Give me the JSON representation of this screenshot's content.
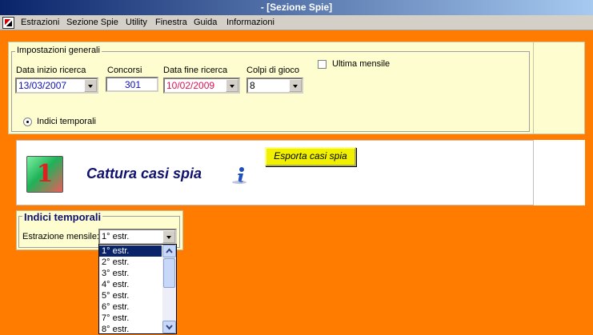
{
  "window": {
    "title": "- [Sezione Spie]"
  },
  "menu": [
    "Estrazioni",
    "Sezione Spie",
    "Utility",
    "Finestra",
    "Guida",
    "Informazioni"
  ],
  "settings": {
    "group_label": "Impostazioni generali",
    "start_date_label": "Data inizio ricerca",
    "start_date_value": "13/03/2007",
    "concorsi_label": "Concorsi",
    "concorsi_value": "301",
    "end_date_label": "Data fine ricerca",
    "end_date_value": "10/02/2009",
    "colpi_label": "Colpi di gioco",
    "colpi_value": "8",
    "ultima_mensile_label": "Ultima mensile",
    "indici_radio_label": "Indici temporali"
  },
  "cattura": {
    "logo_number": "1",
    "title": "Cattura casi spia",
    "export_button": "Esporta casi spia"
  },
  "indici": {
    "title": "Indici temporali",
    "estrazione_label": "Estrazione mensile:",
    "selected": "1° estr.",
    "options": [
      "1° estr.",
      "2° estr.",
      "3° estr.",
      "4° estr.",
      "5° estr.",
      "6° estr.",
      "7° estr.",
      "8° estr."
    ]
  },
  "colors": {
    "background": "#ff7c00",
    "panel": "#fdfdd0",
    "title_blue": "#101070",
    "export_yellow": "#f0f000"
  }
}
